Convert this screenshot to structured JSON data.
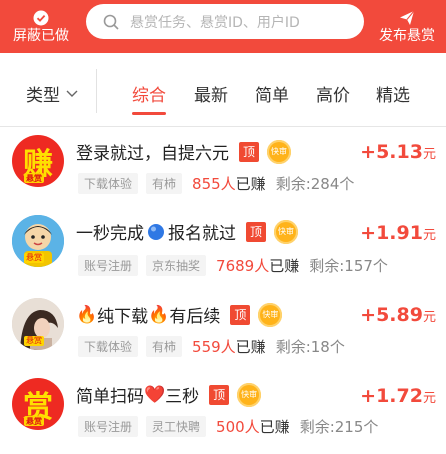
{
  "header": {
    "left_label": "屏蔽已做",
    "search_placeholder": "悬赏任务、悬赏ID、用户ID",
    "right_label": "发布悬赏",
    "colors": {
      "brand": "#f24a3c"
    }
  },
  "filters": {
    "type_label": "类型",
    "tabs": [
      {
        "label": "综合",
        "active": true
      },
      {
        "label": "最新",
        "active": false
      },
      {
        "label": "简单",
        "active": false
      },
      {
        "label": "高价",
        "active": false
      },
      {
        "label": "精选",
        "active": false
      }
    ]
  },
  "tasks": [
    {
      "avatar_text": "赚",
      "avatar_badge": "悬赏",
      "title": "登录就过，自提六元",
      "top_badge": "顶",
      "fast_badge": "快审",
      "reward": "+5.13",
      "unit": "元",
      "tags": [
        "下载体验",
        "有柿"
      ],
      "count": "855人",
      "count_suffix": "已赚",
      "remain": "剩余:284个"
    },
    {
      "avatar_icon": "cartoon-avatar",
      "avatar_badge": "悬赏",
      "title": "一秒完成",
      "title_tail": "报名就过",
      "top_badge": "顶",
      "fast_badge": "快审",
      "reward": "+1.91",
      "unit": "元",
      "tags": [
        "账号注册",
        "京东抽奖"
      ],
      "count": "7689人",
      "count_suffix": "已赚",
      "remain": "剩余:157个"
    },
    {
      "avatar_icon": "photo-avatar",
      "avatar_badge": "悬赏",
      "title_prefix": "🔥",
      "title": "纯下载",
      "title_mid": "🔥",
      "title_tail": "有后续",
      "top_badge": "顶",
      "fast_badge": "快审",
      "reward": "+5.89",
      "unit": "元",
      "tags": [
        "下载体验",
        "有柿"
      ],
      "count": "559人",
      "count_suffix": "已赚",
      "remain": "剩余:18个"
    },
    {
      "avatar_text": "赏",
      "avatar_badge": "悬赏",
      "title": "简单扫码",
      "title_mid": "❤️",
      "title_tail": "三秒",
      "top_badge": "顶",
      "fast_badge": "快审",
      "reward": "+1.72",
      "unit": "元",
      "tags": [
        "账号注册",
        "灵工快聘"
      ],
      "count": "500人",
      "count_suffix": "已赚",
      "remain": "剩余:215个"
    }
  ]
}
